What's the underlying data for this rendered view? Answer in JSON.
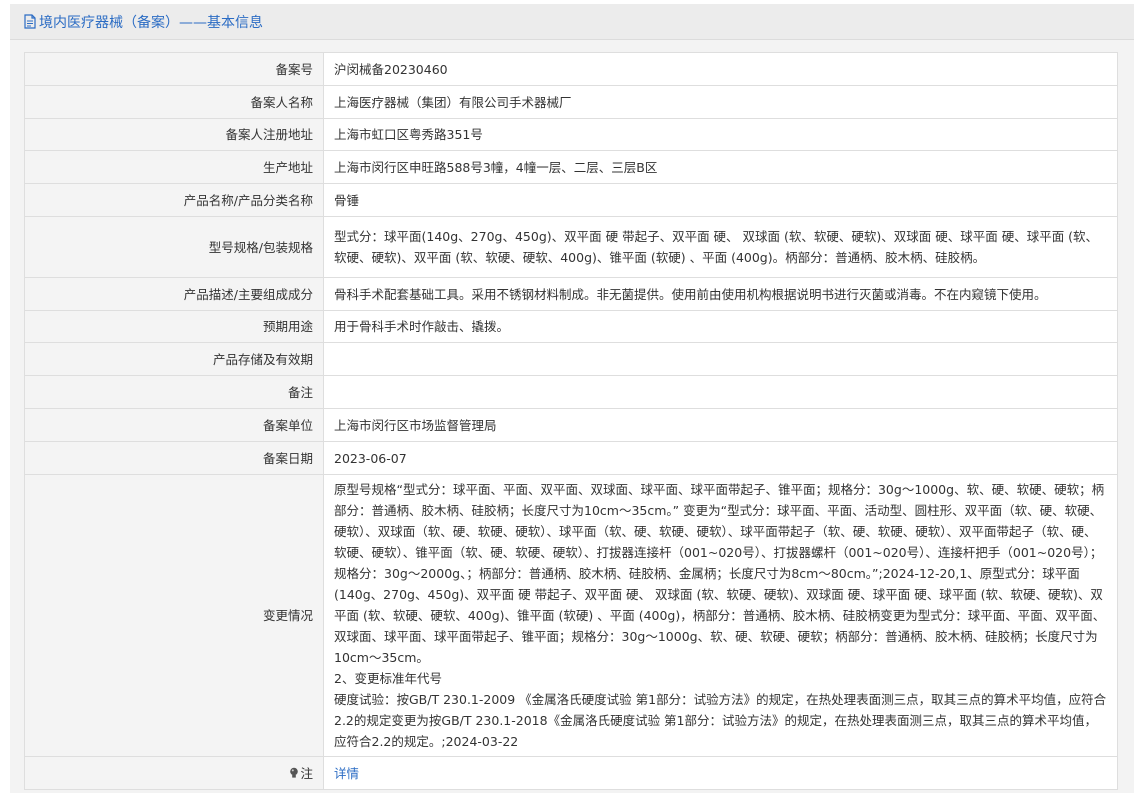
{
  "header": {
    "title": "境内医疗器械（备案）——基本信息"
  },
  "rows": {
    "record_no": {
      "label": "备案号",
      "value": "沪闵械备20230460"
    },
    "applicant": {
      "label": "备案人名称",
      "value": "上海医疗器械（集团）有限公司手术器械厂"
    },
    "applicant_address": {
      "label": "备案人注册地址",
      "value": "上海市虹口区粤秀路351号"
    },
    "production_address": {
      "label": "生产地址",
      "value": "上海市闵行区申旺路588号3幢，4幢一层、二层、三层B区"
    },
    "product_name": {
      "label": "产品名称/产品分类名称",
      "value": "骨锤"
    },
    "model_spec": {
      "label": "型号规格/包装规格",
      "value": "型式分：球平面(140g、270g、450g)、双平面 硬 带起子、双平面 硬、 双球面 (软、软硬、硬软)、双球面 硬、球平面 硬、球平面 (软、软硬、硬软)、双平面 (软、软硬、硬软、400g)、锥平面 (软硬) 、平面 (400g)。柄部分：普通柄、胶木柄、硅胶柄。"
    },
    "description": {
      "label": "产品描述/主要组成成分",
      "value": "骨科手术配套基础工具。采用不锈钢材料制成。非无菌提供。使用前由使用机构根据说明书进行灭菌或消毒。不在内窥镜下使用。"
    },
    "intended_use": {
      "label": "预期用途",
      "value": "用于骨科手术时作敲击、撬拨。"
    },
    "storage": {
      "label": "产品存储及有效期",
      "value": ""
    },
    "remark": {
      "label": "备注",
      "value": ""
    },
    "authority": {
      "label": "备案单位",
      "value": "上海市闵行区市场监督管理局"
    },
    "record_date": {
      "label": "备案日期",
      "value": "2023-06-07"
    },
    "changes": {
      "label": "变更情况",
      "p1": "原型号规格“型式分：球平面、平面、双平面、双球面、球平面、球平面带起子、锥平面；规格分：30g～1000g、软、硬、软硬、硬软；柄部分：普通柄、胶木柄、硅胶柄；长度尺寸为10cm～35cm。”  变更为“型式分：球平面、平面、活动型、圆柱形、双平面（软、硬、软硬、硬软）、双球面（软、硬、软硬、硬软）、球平面（软、硬、软硬、硬软）、球平面带起子（软、硬、软硬、硬软）、双平面带起子（软、硬、软硬、硬软）、锥平面（软、硬、软硬、硬软）、打拔器连接杆（001~020号）、打拔器螺杆（001~020号）、连接杆把手（001~020号）；规格分：30g～2000g、；柄部分：普通柄、胶木柄、硅胶柄、金属柄；长度尺寸为8cm～80cm。”;2024-12-20,1、原型式分：球平面(140g、270g、450g)、双平面 硬 带起子、双平面 硬、 双球面 (软、软硬、硬软)、双球面 硬、球平面 硬、球平面 (软、软硬、硬软)、双平面 (软、软硬、硬软、400g)、锥平面 (软硬) 、平面 (400g)，柄部分：普通柄、胶木柄、硅胶柄变更为型式分：球平面、平面、双平面、双球面、球平面、球平面带起子、锥平面；规格分：30g～1000g、软、硬、软硬、硬软；柄部分：普通柄、胶木柄、硅胶柄；长度尺寸为10cm～35cm。",
      "p2": "2、变更标准年代号",
      "p3": "硬度试验：按GB/T 230.1-2009 《金属洛氏硬度试验 第1部分：试验方法》的规定，在热处理表面测三点，取其三点的算术平均值，应符合2.2的规定变更为按GB/T 230.1-2018《金属洛氏硬度试验 第1部分：试验方法》的规定，在热处理表面测三点，取其三点的算术平均值，应符合2.2的规定。;2024-03-22"
    },
    "note": {
      "label": "注",
      "link": "详情"
    }
  },
  "icons": {
    "header": "document-icon",
    "note": "lightbulb-icon"
  },
  "colors": {
    "link": "#2b6cc4",
    "label_bg": "#f4f4f4",
    "border": "#dedede"
  }
}
